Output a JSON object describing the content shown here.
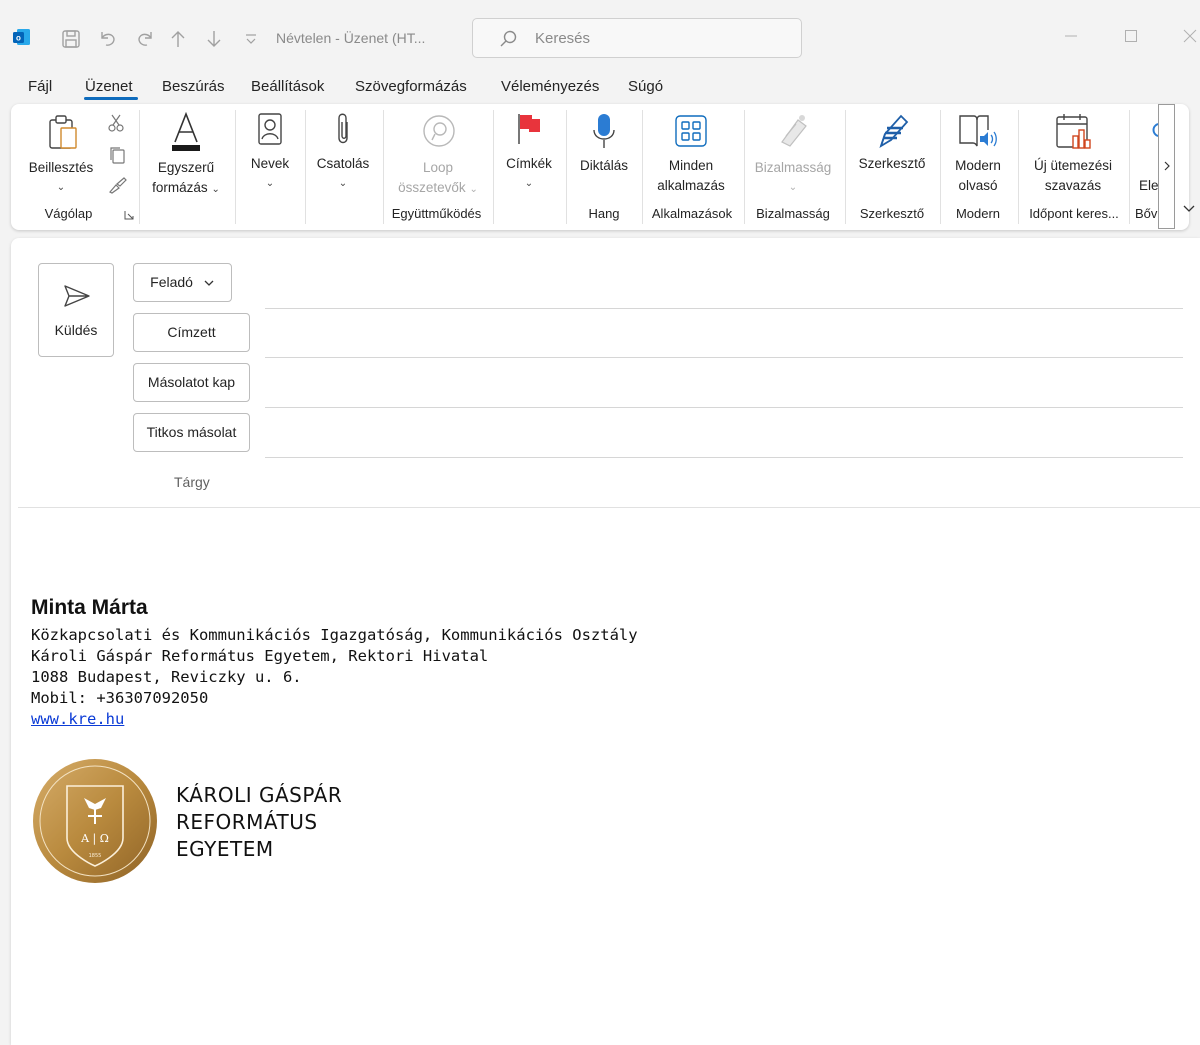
{
  "window": {
    "title": "Névtelen - Üzenet (HT...",
    "search_placeholder": "Keresés"
  },
  "menu": {
    "tabs": [
      "Fájl",
      "Üzenet",
      "Beszúrás",
      "Beállítások",
      "Szövegformázás",
      "Véleményezés",
      "Súgó"
    ],
    "active_tab": "Üzenet"
  },
  "ribbon": {
    "paste": "Beillesztés",
    "basic_format_1": "Egyszerű",
    "basic_format_2": "formázás",
    "names": "Nevek",
    "attach": "Csatolás",
    "loop_1": "Loop",
    "loop_2": "összetevők",
    "tags": "Címkék",
    "dictate": "Diktálás",
    "all_apps_1": "Minden",
    "all_apps_2": "alkalmazás",
    "sensitivity": "Bizalmasság",
    "editor": "Szerkesztő",
    "reader_1": "Modern",
    "reader_2": "olvasó",
    "poll_1": "Új ütemezési",
    "poll_2": "szavazás",
    "cut_off": "Ele",
    "groups": {
      "clipboard": "Vágólap",
      "collab": "Együttműködés",
      "voice": "Hang",
      "apps": "Alkalmazások",
      "sensitivity": "Bizalmasság",
      "editor": "Szerkesztő",
      "modern": "Modern",
      "findtime": "Időpont keres...",
      "addins": "Bővi"
    }
  },
  "compose": {
    "send": "Küldés",
    "from": "Feladó",
    "to": "Címzett",
    "cc": "Másolatot kap",
    "bcc": "Titkos másolat",
    "subject": "Tárgy"
  },
  "signature": {
    "name": "Minta Márta",
    "line1": "Közkapcsolati és Kommunikációs Igazgatóság, Kommunikációs Osztály",
    "line2": "Károli Gáspár Református Egyetem, Rektori Hivatal",
    "line3": "1088 Budapest, Reviczky u. 6.",
    "line4": "Mobil: +36307092050",
    "link": "www.kre.hu",
    "logo_line1": "KÁROLI GÁSPÁR",
    "logo_line2": "REFORMÁTUS",
    "logo_line3": "EGYETEM",
    "seal_text": "A | Ω",
    "seal_year": "1855"
  },
  "colors": {
    "accent": "#0f6cbd",
    "flag": "#e8343c",
    "gold": "#b98a3e",
    "link": "#0b3bd6"
  }
}
